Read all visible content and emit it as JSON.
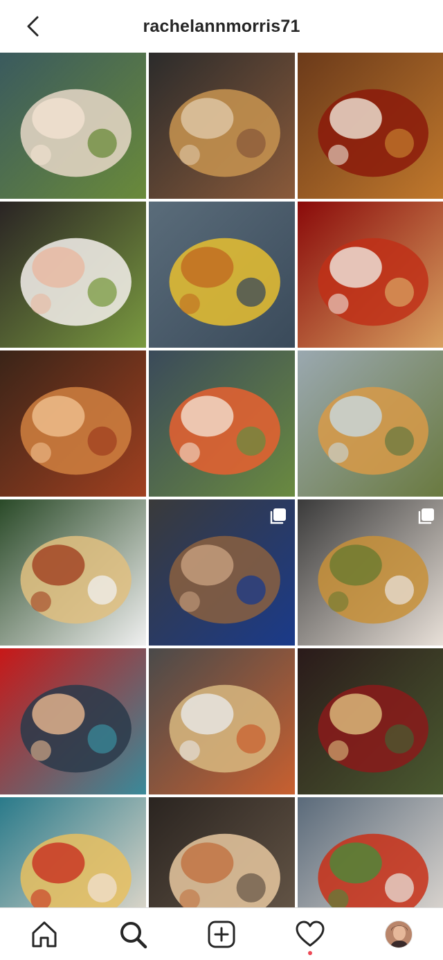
{
  "header": {
    "title": "rachelannmorris71",
    "back_icon": "chevron-left-icon"
  },
  "grid": {
    "posts": [
      {
        "name": "post-ceviche",
        "colors": [
          "#3a5a5e",
          "#e8d8c8",
          "#f2e2d2",
          "#6a8a3a"
        ],
        "multi": false
      },
      {
        "name": "post-fried-dumplings",
        "colors": [
          "#2b2b2b",
          "#c89450",
          "#e0c8a8",
          "#8a5a3a"
        ],
        "multi": false
      },
      {
        "name": "post-tea-glass",
        "colors": [
          "#6b3a1a",
          "#8b1a0a",
          "#f0e6d8",
          "#c0782c"
        ],
        "multi": false
      },
      {
        "name": "post-sashimi-platter",
        "colors": [
          "#2a2424",
          "#f4f0ec",
          "#e8b8a0",
          "#7a9a40"
        ],
        "multi": false
      },
      {
        "name": "post-seafood-dishes",
        "colors": [
          "#5a6c7a",
          "#e8c030",
          "#c06a20",
          "#3a4a5a"
        ],
        "multi": false
      },
      {
        "name": "post-chili-chicken",
        "colors": [
          "#8a0a0a",
          "#c03018",
          "#f0e8e0",
          "#d8a060"
        ],
        "multi": false
      },
      {
        "name": "post-scallop",
        "colors": [
          "#3a2418",
          "#d08040",
          "#f0c090",
          "#a04020"
        ],
        "multi": false
      },
      {
        "name": "post-sushi-plate",
        "colors": [
          "#3a4a5a",
          "#e86030",
          "#f4e0d0",
          "#6a8a40"
        ],
        "multi": false
      },
      {
        "name": "post-poke-bowls",
        "colors": [
          "#9aa8b0",
          "#d89a48",
          "#c8d8e0",
          "#6a7a40"
        ],
        "multi": false
      },
      {
        "name": "post-canapes-tray",
        "colors": [
          "#2a4a28",
          "#e0c080",
          "#a04020",
          "#f0f0f0"
        ],
        "multi": false
      },
      {
        "name": "post-chef-carving",
        "colors": [
          "#3a3a3a",
          "#8a6040",
          "#c8a080",
          "#1a3a8a"
        ],
        "multi": true
      },
      {
        "name": "post-skewers",
        "colors": [
          "#3a3a3a",
          "#c89038",
          "#6a7a30",
          "#e8e0d8"
        ],
        "multi": true
      },
      {
        "name": "post-woman-burger",
        "colors": [
          "#c81818",
          "#2a3a4a",
          "#e8b890",
          "#3a8a9a"
        ],
        "multi": false
      },
      {
        "name": "post-open-kitchen",
        "colors": [
          "#4a4a4a",
          "#d8b880",
          "#e8e8e8",
          "#c86030"
        ],
        "multi": false
      },
      {
        "name": "post-charcuterie",
        "colors": [
          "#2a1a1a",
          "#8a1a1a",
          "#e0c080",
          "#4a5a30"
        ],
        "multi": false
      },
      {
        "name": "post-breakfast-latte",
        "colors": [
          "#2a7a8a",
          "#e8c060",
          "#c83020",
          "#f0e0d0"
        ],
        "multi": false
      },
      {
        "name": "post-woman-pizza",
        "colors": [
          "#2a2420",
          "#e8c8a0",
          "#c07040",
          "#6a5a4a"
        ],
        "multi": false
      },
      {
        "name": "post-mezze-spread",
        "colors": [
          "#5a6a7a",
          "#c83018",
          "#4a8a3a",
          "#e8e0d8"
        ],
        "multi": false
      }
    ]
  },
  "tabbar": {
    "tabs": [
      {
        "name": "tab-home",
        "icon": "home-icon"
      },
      {
        "name": "tab-search",
        "icon": "search-icon"
      },
      {
        "name": "tab-create",
        "icon": "plus-square-icon"
      },
      {
        "name": "tab-activity",
        "icon": "heart-icon"
      },
      {
        "name": "tab-profile",
        "icon": "avatar"
      }
    ],
    "notification_dot_color": "#ed4956"
  },
  "colors": {
    "text": "#262626",
    "divider": "#dbdbdb",
    "background": "#ffffff"
  }
}
